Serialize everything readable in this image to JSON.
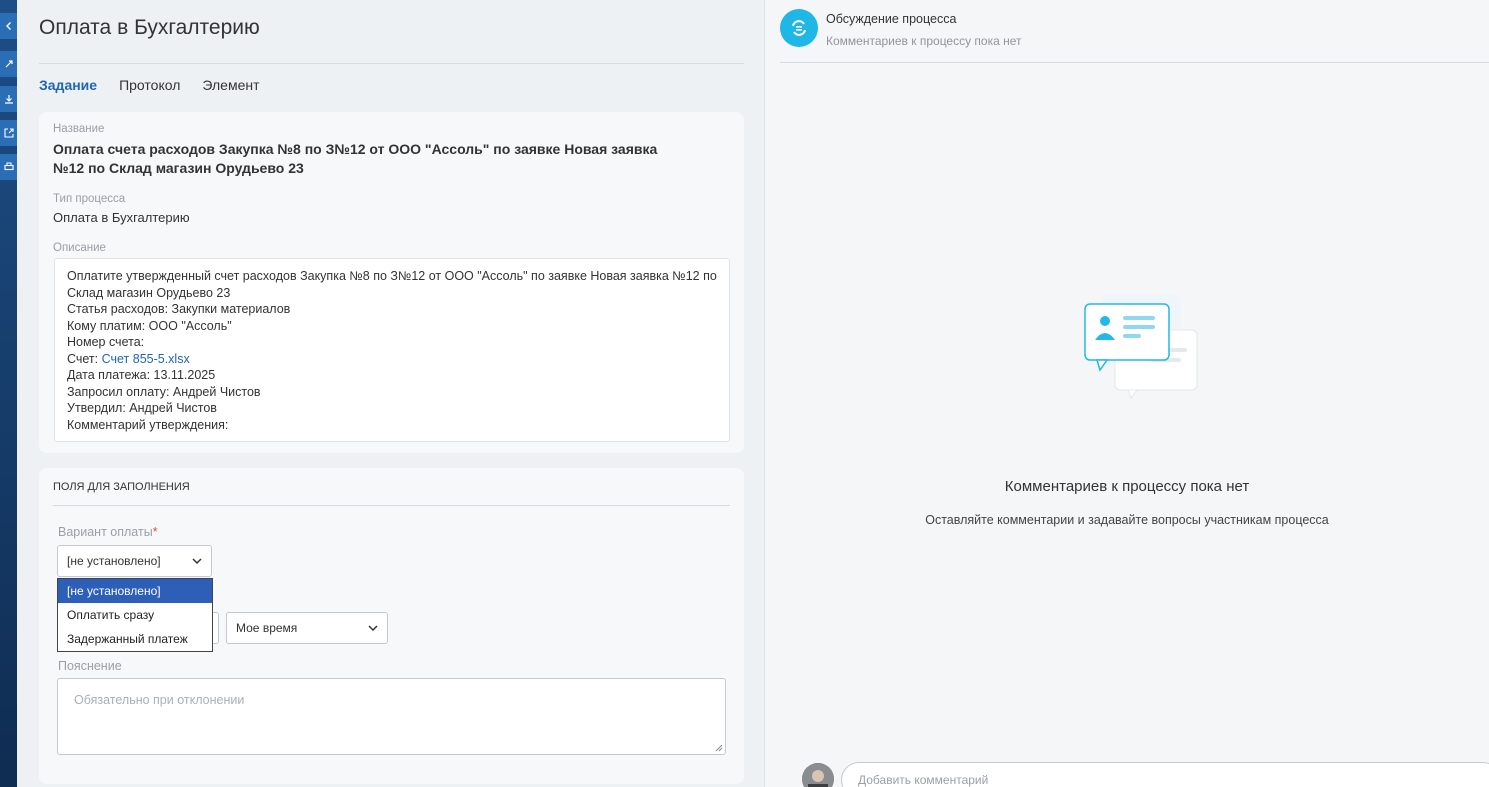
{
  "page": {
    "title": "Оплата в Бухгалтерию",
    "tabs": [
      {
        "label": "Задание",
        "active": true
      },
      {
        "label": "Протокол",
        "active": false
      },
      {
        "label": "Элемент",
        "active": false
      }
    ]
  },
  "info": {
    "name_label": "Название",
    "name_value": "Оплата счета расходов Закупка №8 по З№12 от ООО \"Ассоль\" по заявке Новая заявка №12 по Склад магазин Орудьево 23",
    "process_type_label": "Тип процесса",
    "process_type_value": "Оплата в Бухгалтерию",
    "description_label": "Описание",
    "description": {
      "line1": "Оплатите утвержденный счет расходов Закупка №8 по З№12 от ООО \"Ассоль\" по заявке Новая заявка №12 по Склад магазин Орудьево 23",
      "line2": "Статья расходов: Закупки материалов",
      "line3": "Кому платим: ООО \"Ассоль\"",
      "line4": "Номер счета:",
      "invoice_prefix": "Счет: ",
      "invoice_link": "Счет 855-5.xlsx",
      "line6": "Дата платежа: 13.11.2025",
      "line7": "Запросил оплату: Андрей Чистов",
      "line8": "Утвердил: Андрей Чистов",
      "line9": "Комментарий утверждения:"
    }
  },
  "form": {
    "section_title": "ПОЛЯ ДЛЯ ЗАПОЛНЕНИЯ",
    "payment_variant_label": "Вариант оплаты",
    "required_mark": "*",
    "payment_variant_value": "[не установлено]",
    "dropdown_options": [
      "[не установлено]",
      "Оплатить сразу",
      "Задержанный платеж"
    ],
    "selected_option_index": 0,
    "time_select_value": "Мое время",
    "explanation_label": "Пояснение",
    "explanation_placeholder": "Обязательно при отклонении"
  },
  "discussion": {
    "title": "Обсуждение процесса",
    "subtitle": "Комментариев к процессу пока нет",
    "empty_title": "Комментариев к процессу пока нет",
    "empty_subtitle": "Оставляйте комментарии и задавайте вопросы участникам процесса",
    "comment_placeholder": "Добавить комментарий"
  },
  "colors": {
    "accent": "#2066b0",
    "discussion_icon": "#1fb8e6",
    "dropdown_selected": "#2e5fb8",
    "sidebar": "#163d6b"
  },
  "icons": {
    "sidebar": [
      "chevron-left-icon",
      "link-icon",
      "download-icon",
      "external-link-icon",
      "print-icon"
    ],
    "discussion": "chat-refresh-icon",
    "empty_state": "chat-bubbles-illustration"
  }
}
